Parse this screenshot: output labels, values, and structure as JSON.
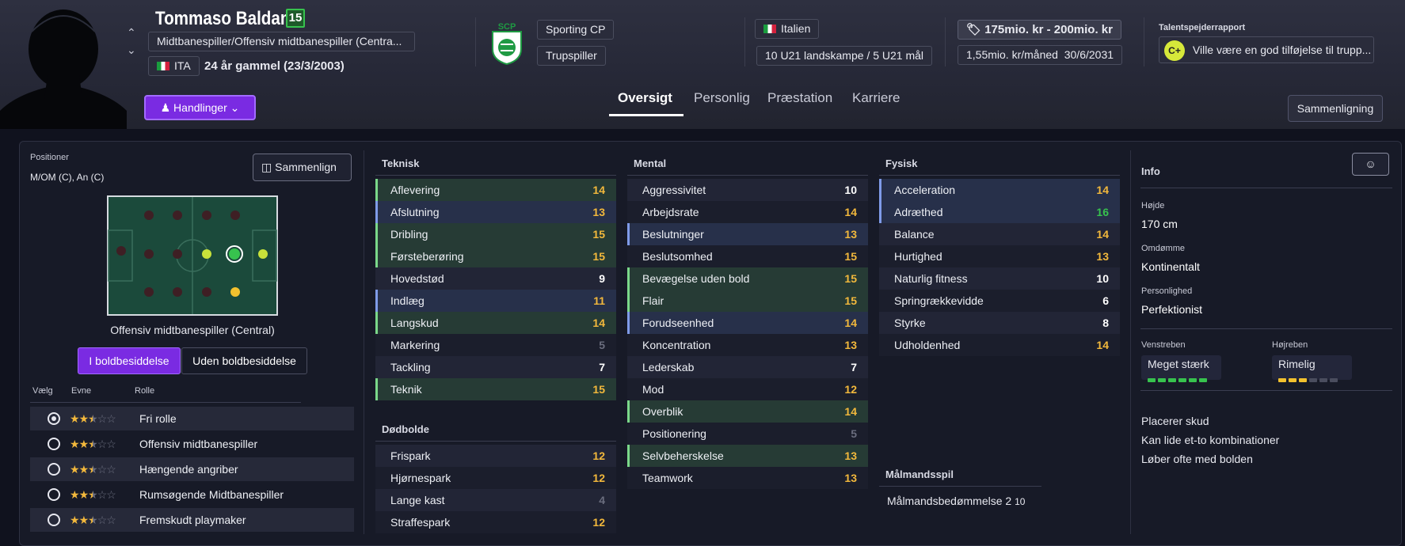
{
  "player": {
    "name": "Tommaso Baldanzi",
    "number": "15",
    "position": "Midtbanespiller/Offensiv midtbanespiller (Centra...",
    "nationality_code": "ITA",
    "age": "24 år gammel (23/3/2003)"
  },
  "club": {
    "name": "Sporting CP",
    "status": "Trupspiller",
    "crest_text": "SCP"
  },
  "nation": {
    "name": "Italien",
    "caps": "10 U21 landskampe / 5 U21 mål"
  },
  "value": {
    "range": "175mio. kr - 200mio. kr",
    "wage": "1,55mio. kr/måned",
    "contract": "30/6/2031"
  },
  "scout": {
    "title": "Talentspejderrapport",
    "grade": "C+",
    "text": "Ville være en god tilføjelse til trupp..."
  },
  "actions_label": "Handlinger",
  "tabs": [
    "Oversigt",
    "Personlig",
    "Præstation",
    "Karriere"
  ],
  "compare_label": "Sammenligning",
  "positions": {
    "label": "Positioner",
    "value": "M/OM (C), An (C)",
    "compare_btn": "Sammenlign",
    "role_title": "Offensiv midtbanespiller (Central)"
  },
  "toggle": {
    "with_ball": "I boldbesiddelse",
    "without_ball": "Uden boldbesiddelse"
  },
  "roles_header": {
    "select": "Vælg",
    "ability": "Evne",
    "role": "Rolle"
  },
  "roles": [
    {
      "name": "Fri rolle",
      "stars": 2.5,
      "selected": true
    },
    {
      "name": "Offensiv midtbanespiller",
      "stars": 2.5,
      "selected": false
    },
    {
      "name": "Hængende angriber",
      "stars": 2.5,
      "selected": false
    },
    {
      "name": "Rumsøgende Midtbanespiller",
      "stars": 2.5,
      "selected": false
    },
    {
      "name": "Fremskudt playmaker",
      "stars": 2.5,
      "selected": false
    }
  ],
  "technical": {
    "title": "Teknisk",
    "attrs": [
      {
        "name": "Aflevering",
        "value": "14",
        "hl": "green"
      },
      {
        "name": "Afslutning",
        "value": "13",
        "hl": "blue"
      },
      {
        "name": "Dribling",
        "value": "15",
        "hl": "green"
      },
      {
        "name": "Førsteberøring",
        "value": "15",
        "hl": "green"
      },
      {
        "name": "Hovedstød",
        "value": "9",
        "hl": ""
      },
      {
        "name": "Indlæg",
        "value": "11",
        "hl": "blue"
      },
      {
        "name": "Langskud",
        "value": "14",
        "hl": "green"
      },
      {
        "name": "Markering",
        "value": "5",
        "hl": ""
      },
      {
        "name": "Tackling",
        "value": "7",
        "hl": ""
      },
      {
        "name": "Teknik",
        "value": "15",
        "hl": "green"
      }
    ]
  },
  "set_pieces": {
    "title": "Dødbolde",
    "attrs": [
      {
        "name": "Frispark",
        "value": "12",
        "hl": ""
      },
      {
        "name": "Hjørnespark",
        "value": "12",
        "hl": ""
      },
      {
        "name": "Lange kast",
        "value": "4",
        "hl": ""
      },
      {
        "name": "Straffespark",
        "value": "12",
        "hl": ""
      }
    ]
  },
  "mental": {
    "title": "Mental",
    "attrs": [
      {
        "name": "Aggressivitet",
        "value": "10",
        "hl": ""
      },
      {
        "name": "Arbejdsrate",
        "value": "14",
        "hl": ""
      },
      {
        "name": "Beslutninger",
        "value": "13",
        "hl": "blue"
      },
      {
        "name": "Beslutsomhed",
        "value": "15",
        "hl": ""
      },
      {
        "name": "Bevægelse uden bold",
        "value": "15",
        "hl": "green"
      },
      {
        "name": "Flair",
        "value": "15",
        "hl": "green"
      },
      {
        "name": "Forudseenhed",
        "value": "14",
        "hl": "blue"
      },
      {
        "name": "Koncentration",
        "value": "13",
        "hl": ""
      },
      {
        "name": "Lederskab",
        "value": "7",
        "hl": ""
      },
      {
        "name": "Mod",
        "value": "12",
        "hl": ""
      },
      {
        "name": "Overblik",
        "value": "14",
        "hl": "green"
      },
      {
        "name": "Positionering",
        "value": "5",
        "hl": ""
      },
      {
        "name": "Selvbeherskelse",
        "value": "13",
        "hl": "green"
      },
      {
        "name": "Teamwork",
        "value": "13",
        "hl": ""
      }
    ]
  },
  "physical": {
    "title": "Fysisk",
    "attrs": [
      {
        "name": "Acceleration",
        "value": "14",
        "hl": "blue"
      },
      {
        "name": "Adræthed",
        "value": "16",
        "hl": "blue"
      },
      {
        "name": "Balance",
        "value": "14",
        "hl": ""
      },
      {
        "name": "Hurtighed",
        "value": "13",
        "hl": ""
      },
      {
        "name": "Naturlig fitness",
        "value": "10",
        "hl": ""
      },
      {
        "name": "Springrækkevidde",
        "value": "6",
        "hl": ""
      },
      {
        "name": "Styrke",
        "value": "8",
        "hl": ""
      },
      {
        "name": "Udholdenhed",
        "value": "14",
        "hl": ""
      }
    ]
  },
  "goalkeeping": {
    "title": "Målmandsspil",
    "rating_label": "Målmandsbedømmelse",
    "rating_value": "2",
    "rating_max": "10"
  },
  "info": {
    "title": "Info",
    "height_label": "Højde",
    "height": "170 cm",
    "reputation_label": "Omdømme",
    "reputation": "Kontinentalt",
    "personality_label": "Personlighed",
    "personality": "Perfektionist",
    "left_foot_label": "Venstreben",
    "left_foot": "Meget stærk",
    "left_foot_level": 6,
    "right_foot_label": "Højreben",
    "right_foot": "Rimelig",
    "right_foot_level": 3,
    "traits": [
      "Placerer skud",
      "Kan lide et-to kombinationer",
      "Løber ofte med bolden"
    ]
  },
  "colors": {
    "green_val": "#37c24e",
    "orange_val": "#f2b83c",
    "white_val": "#ffffff",
    "grey_val": "#6a6d7e",
    "accent": "#7a2be2"
  }
}
